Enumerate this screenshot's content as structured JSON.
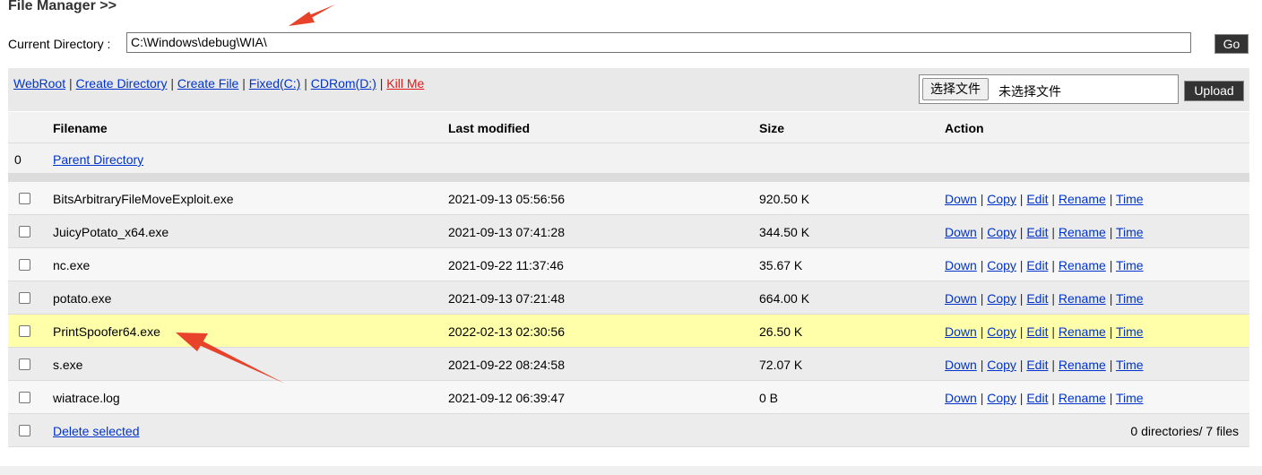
{
  "header": {
    "title": "File Manager >>"
  },
  "current_directory": {
    "label": "Current Directory :",
    "value": "C:\\Windows\\debug\\WIA\\",
    "go_label": "Go"
  },
  "toolbar": {
    "links": [
      "WebRoot",
      "Create Directory",
      "Create File",
      "Fixed(C:)",
      "CDRom(D:)"
    ],
    "kill_label": "Kill Me",
    "separator": "|",
    "choose_file_label": "选择文件",
    "no_file_label": "未选择文件",
    "upload_label": "Upload"
  },
  "table": {
    "columns": [
      "Filename",
      "Last modified",
      "Size",
      "Action"
    ],
    "parent": {
      "index": "0",
      "label": "Parent Directory"
    },
    "actions": [
      "Down",
      "Copy",
      "Edit",
      "Rename",
      "Time"
    ],
    "files": [
      {
        "name": "BitsArbitraryFileMoveExploit.exe",
        "modified": "2021-09-13 05:56:56",
        "size": "920.50 K"
      },
      {
        "name": "JuicyPotato_x64.exe",
        "modified": "2021-09-13 07:41:28",
        "size": "344.50 K"
      },
      {
        "name": "nc.exe",
        "modified": "2021-09-22 11:37:46",
        "size": "35.67 K"
      },
      {
        "name": "potato.exe",
        "modified": "2021-09-13 07:21:48",
        "size": "664.00 K"
      },
      {
        "name": "PrintSpoofer64.exe",
        "modified": "2022-02-13 02:30:56",
        "size": "26.50 K"
      },
      {
        "name": "s.exe",
        "modified": "2021-09-22 08:24:58",
        "size": "72.07 K"
      },
      {
        "name": "wiatrace.log",
        "modified": "2021-09-12 06:39:47",
        "size": "0 B"
      }
    ],
    "delete_label": "Delete selected",
    "summary": "0 directories/ 7 files"
  },
  "colors": {
    "highlight_row": "#ffffaa",
    "annotation_arrow": "#e8432a",
    "link": "#0033cc",
    "kill_link": "#e01818"
  }
}
